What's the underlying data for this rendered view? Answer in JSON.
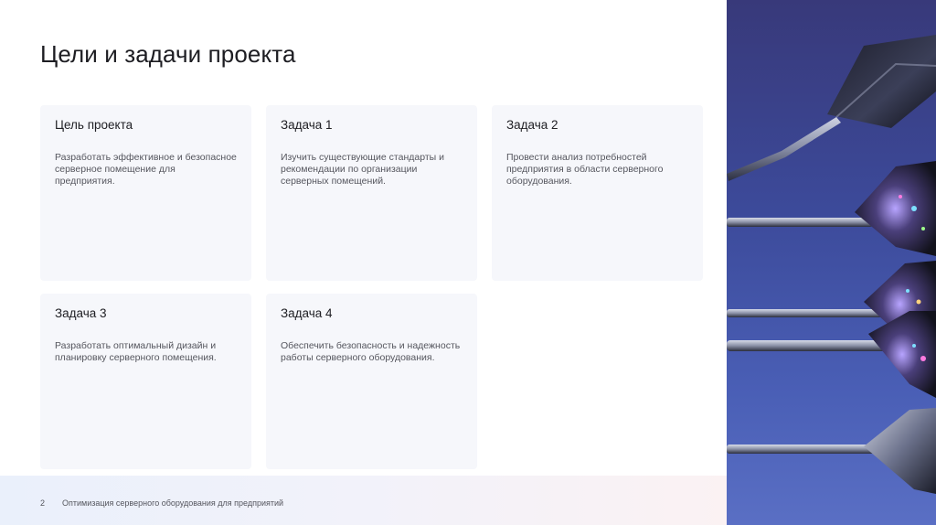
{
  "slide": {
    "title": "Цели и задачи проекта",
    "cards": [
      {
        "title": "Цель проекта",
        "body": "Разработать эффективное и безопасное серверное помещение для предприятия."
      },
      {
        "title": "Задача 1",
        "body": "Изучить существующие стандарты и рекомендации по организации серверных помещений."
      },
      {
        "title": "Задача 2",
        "body": "Провести анализ потребностей предприятия в области серверного оборудования."
      },
      {
        "title": "Задача 3",
        "body": "Разработать оптимальный дизайн и планировку серверного помещения."
      },
      {
        "title": "Задача 4",
        "body": "Обеспечить безопасность и надежность работы серверного оборудования."
      }
    ],
    "footer": {
      "page_number": "2",
      "text": "Оптимизация серверного оборудования для предприятий"
    },
    "image": {
      "subject": "darts-photo"
    }
  }
}
